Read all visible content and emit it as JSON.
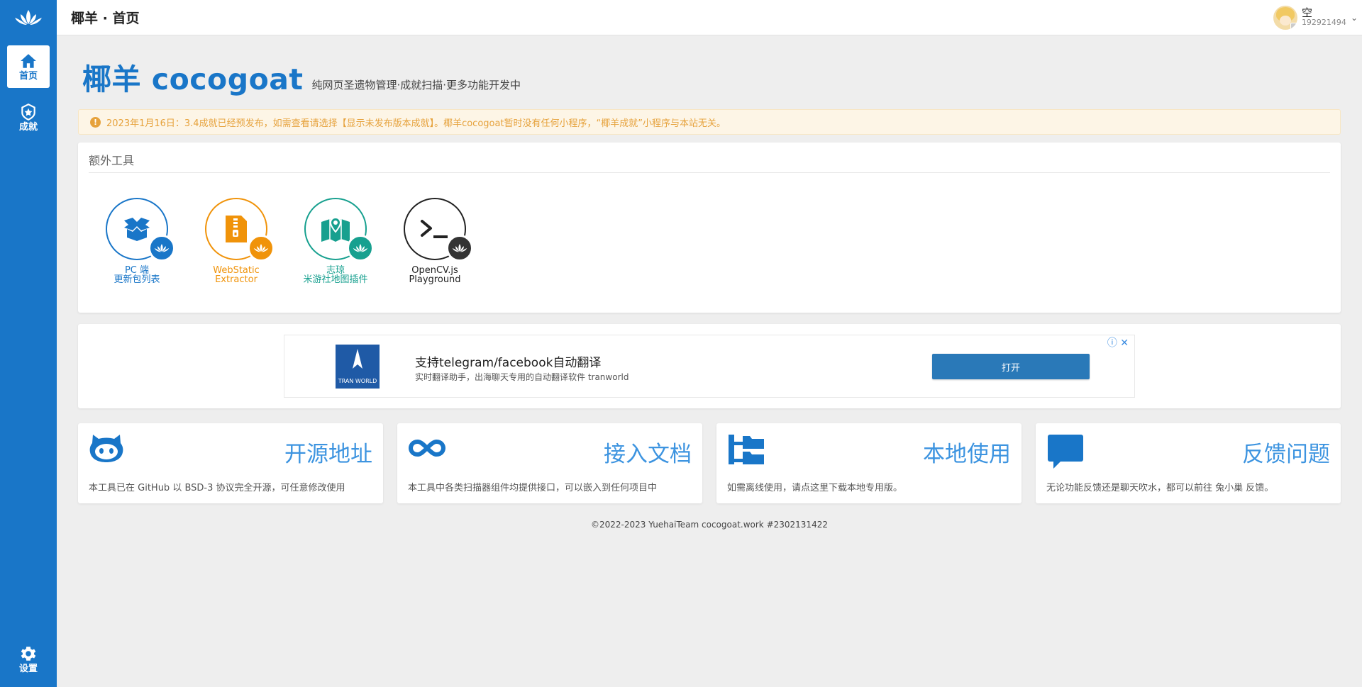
{
  "header": {
    "breadcrumb": "椰羊 · 首页",
    "user": {
      "name": "空",
      "id": "192921494"
    }
  },
  "sidebar": {
    "items": [
      {
        "label": "首页",
        "icon": "home-icon",
        "active": true
      },
      {
        "label": "成就",
        "icon": "achievement-icon",
        "active": false
      }
    ],
    "settings_label": "设置"
  },
  "main": {
    "brand": "椰羊 cocogoat",
    "subtitle": "纯网页圣遗物管理·成就扫描·更多功能开发中",
    "notice": "2023年1月16日：3.4成就已经预发布，如需查看请选择【显示未发布版本成就】。椰羊cocogoat暂时没有任何小程序，“椰羊成就”小程序与本站无关。",
    "tools": {
      "heading": "额外工具",
      "items": [
        {
          "line1": "PC 端",
          "line2": "更新包列表",
          "color": "#1976c8",
          "icon": "box-icon"
        },
        {
          "line1": "WebStatic",
          "line2": "Extractor",
          "color": "#f0930a",
          "icon": "zip-file-icon"
        },
        {
          "line1": "志琼",
          "line2": "米游社地图插件",
          "color": "#17a08f",
          "icon": "map-icon"
        },
        {
          "line1": "OpenCV.js",
          "line2": "Playground",
          "color": "#222222",
          "icon": "terminal-icon"
        }
      ]
    },
    "ad": {
      "logo_text": "TRAN WORLD",
      "title": "支持telegram/facebook自动翻译",
      "subtitle": "实时翻译助手，出海聊天专用的自动翻译软件 tranworld",
      "button": "打开"
    },
    "features": [
      {
        "title": "开源地址",
        "desc": "本工具已在 GitHub 以 BSD-3 协议完全开源，可任意修改使用",
        "icon": "github-icon"
      },
      {
        "title": "接入文档",
        "desc": "本工具中各类扫描器组件均提供接口，可以嵌入到任何项目中",
        "icon": "infinity-icon"
      },
      {
        "title": "本地使用",
        "desc": "如需离线使用，请点这里下载本地专用版。",
        "icon": "folder-tree-icon"
      },
      {
        "title": "反馈问题",
        "desc": "无论功能反馈还是聊天吹水，都可以前往 兔小巢 反馈。",
        "icon": "chat-icon"
      }
    ]
  },
  "footer": "©2022-2023 YuehaiTeam cocogoat.work #2302131422",
  "colors": {
    "primary": "#1976c8",
    "background": "#eeeeee",
    "notice": "#e6a23c"
  }
}
